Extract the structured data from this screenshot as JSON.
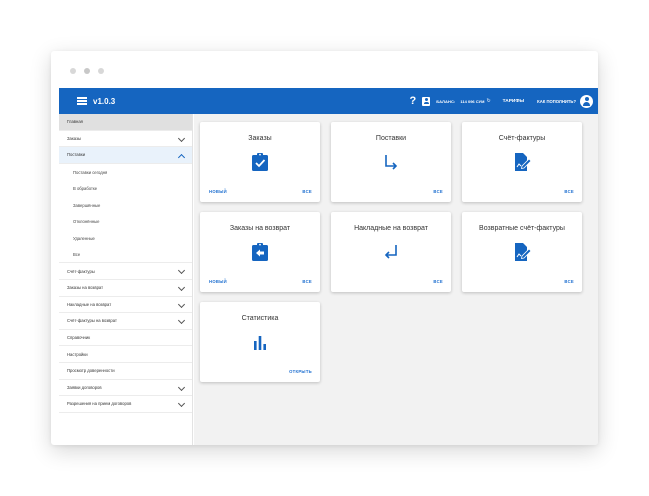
{
  "colors": {
    "primary": "#1565c0",
    "link": "#1e6fd0",
    "main_bg": "#f2f2f2"
  },
  "header": {
    "version": "v1.0.3",
    "help_icon": "?",
    "balance_label": "БАЛАНС:",
    "balance_value": "114 096 СУМ",
    "refresh_icon": "↻",
    "tariffs": "ТАРИФЫ",
    "topup": "КАК ПОПОЛНИТЬ?"
  },
  "sidebar": {
    "items": [
      {
        "label": "Главная"
      },
      {
        "label": "Заказы"
      },
      {
        "label": "Поставки"
      },
      {
        "label": "Поставки сегодня"
      },
      {
        "label": "В обработке"
      },
      {
        "label": "Завершённые"
      },
      {
        "label": "Отклонённые"
      },
      {
        "label": "Удаленные"
      },
      {
        "label": "Все"
      },
      {
        "label": "Счёт-фактуры"
      },
      {
        "label": "Заказы на возврат"
      },
      {
        "label": "Накладные на возврат"
      },
      {
        "label": "Счёт-фактуры на возврат"
      },
      {
        "label": "Справочник"
      },
      {
        "label": "Настройки"
      },
      {
        "label": "Просмотр доверенности"
      },
      {
        "label": "Заявки договоров"
      },
      {
        "label": "Разрешения на прием договоров"
      }
    ]
  },
  "cards": [
    {
      "title": "Заказы",
      "icon": "clipboard-check-icon",
      "link_left": "НОВЫЙ",
      "link_right": "ВСЕ"
    },
    {
      "title": "Поставки",
      "icon": "arrow-down-right-icon",
      "link_right": "ВСЕ"
    },
    {
      "title": "Счёт-фактуры",
      "icon": "document-edit-icon",
      "link_right": "ВСЕ"
    },
    {
      "title": "Заказы на возврат",
      "icon": "clipboard-return-icon",
      "link_left": "НОВЫЙ",
      "link_right": "ВСЕ"
    },
    {
      "title": "Накладные на возврат",
      "icon": "return-arrow-icon",
      "link_right": "ВСЕ"
    },
    {
      "title": "Возвратные счёт-фактуры",
      "icon": "document-edit-icon",
      "link_right": "ВСЕ"
    },
    {
      "title": "Статистика",
      "icon": "bar-chart-icon",
      "link_right": "ОТКРЫТЬ"
    }
  ]
}
